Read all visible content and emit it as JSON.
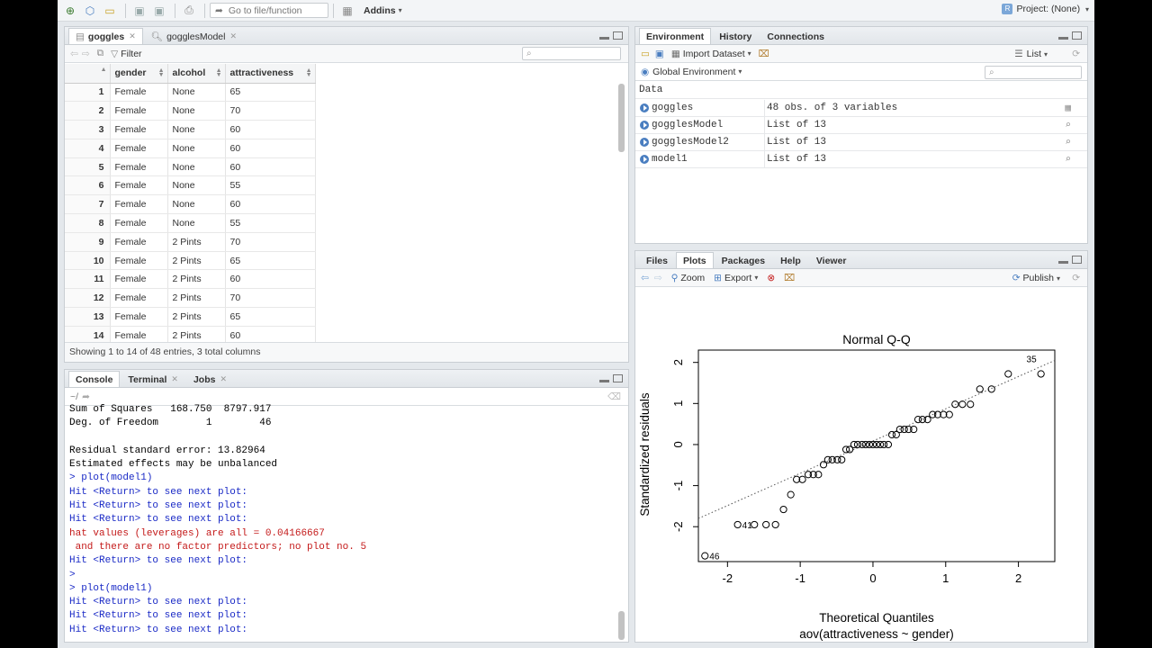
{
  "toolbar": {
    "goto_placeholder": "Go to file/function",
    "addins": "Addins",
    "project": "Project: (None)"
  },
  "source_pane": {
    "tabs": [
      {
        "label": "goggles",
        "active": true
      },
      {
        "label": "gogglesModel",
        "active": false
      }
    ],
    "filter_label": "Filter",
    "columns": [
      "gender",
      "alcohol",
      "attractiveness"
    ],
    "rows": [
      [
        "1",
        "Female",
        "None",
        "65"
      ],
      [
        "2",
        "Female",
        "None",
        "70"
      ],
      [
        "3",
        "Female",
        "None",
        "60"
      ],
      [
        "4",
        "Female",
        "None",
        "60"
      ],
      [
        "5",
        "Female",
        "None",
        "60"
      ],
      [
        "6",
        "Female",
        "None",
        "55"
      ],
      [
        "7",
        "Female",
        "None",
        "60"
      ],
      [
        "8",
        "Female",
        "None",
        "55"
      ],
      [
        "9",
        "Female",
        "2 Pints",
        "70"
      ],
      [
        "10",
        "Female",
        "2 Pints",
        "65"
      ],
      [
        "11",
        "Female",
        "2 Pints",
        "60"
      ],
      [
        "12",
        "Female",
        "2 Pints",
        "70"
      ],
      [
        "13",
        "Female",
        "2 Pints",
        "65"
      ],
      [
        "14",
        "Female",
        "2 Pints",
        "60"
      ]
    ],
    "footer": "Showing 1 to 14 of 48 entries, 3 total columns"
  },
  "console_pane": {
    "tabs": [
      "Console",
      "Terminal",
      "Jobs"
    ],
    "path": "~/",
    "lines": [
      {
        "t": "out",
        "text": "Sum of Squares   168.750  8797.917"
      },
      {
        "t": "out",
        "text": "Deg. of Freedom        1        46"
      },
      {
        "t": "out",
        "text": ""
      },
      {
        "t": "out",
        "text": "Residual standard error: 13.82964"
      },
      {
        "t": "out",
        "text": "Estimated effects may be unbalanced"
      },
      {
        "t": "cmd",
        "text": "> plot(model1)"
      },
      {
        "t": "info",
        "text": "Hit <Return> to see next plot:"
      },
      {
        "t": "info",
        "text": "Hit <Return> to see next plot:"
      },
      {
        "t": "info",
        "text": "Hit <Return> to see next plot:"
      },
      {
        "t": "err",
        "text": "hat values (leverages) are all = 0.04166667"
      },
      {
        "t": "err",
        "text": " and there are no factor predictors; no plot no. 5"
      },
      {
        "t": "info",
        "text": "Hit <Return> to see next plot:"
      },
      {
        "t": "cmd",
        "text": ">"
      },
      {
        "t": "cmd",
        "text": "> plot(model1)"
      },
      {
        "t": "info",
        "text": "Hit <Return> to see next plot:"
      },
      {
        "t": "info",
        "text": "Hit <Return> to see next plot:"
      },
      {
        "t": "info",
        "text": "Hit <Return> to see next plot:"
      }
    ]
  },
  "env_pane": {
    "tabs": [
      {
        "label": "Environment",
        "active": true
      },
      {
        "label": "History",
        "active": false
      },
      {
        "label": "Connections",
        "active": false
      }
    ],
    "import_label": "Import Dataset",
    "view_mode": "List",
    "scope": "Global Environment",
    "section": "Data",
    "items": [
      {
        "name": "goggles",
        "value": "48 obs. of 3 variables",
        "icon": "table-icon"
      },
      {
        "name": "gogglesModel",
        "value": "List of 13",
        "icon": "magnifier-icon"
      },
      {
        "name": "gogglesModel2",
        "value": "List of 13",
        "icon": "magnifier-icon"
      },
      {
        "name": "model1",
        "value": "List of 13",
        "icon": "magnifier-icon"
      }
    ]
  },
  "files_pane": {
    "tabs": [
      {
        "label": "Files",
        "active": false
      },
      {
        "label": "Plots",
        "active": true
      },
      {
        "label": "Packages",
        "active": false
      },
      {
        "label": "Help",
        "active": false
      },
      {
        "label": "Viewer",
        "active": false
      }
    ],
    "zoom_label": "Zoom",
    "export_label": "Export",
    "publish_label": "Publish"
  },
  "chart_data": {
    "type": "scatter",
    "title": "Normal Q-Q",
    "xlabel": "Theoretical Quantiles",
    "subtitle": "aov(attractiveness ~ gender)",
    "ylabel": "Standardized residuals",
    "xlim": [
      -2.4,
      2.5
    ],
    "ylim": [
      -2.85,
      2.3
    ],
    "xticks": [
      -2,
      -1,
      0,
      1,
      2
    ],
    "yticks": [
      -2,
      -1,
      0,
      1,
      2
    ],
    "reference_line": {
      "x": [
        -2.4,
        2.5
      ],
      "y": [
        -1.8,
        2.05
      ]
    },
    "x": [
      -2.31,
      -1.86,
      -1.63,
      -1.47,
      -1.34,
      -1.23,
      -1.13,
      -1.05,
      -0.97,
      -0.89,
      -0.82,
      -0.75,
      -0.68,
      -0.62,
      -0.56,
      -0.49,
      -0.43,
      -0.37,
      -0.32,
      -0.26,
      -0.21,
      -0.15,
      -0.1,
      -0.05,
      0.0,
      0.05,
      0.1,
      0.15,
      0.21,
      0.26,
      0.32,
      0.37,
      0.43,
      0.49,
      0.56,
      0.62,
      0.68,
      0.75,
      0.82,
      0.89,
      0.97,
      1.05,
      1.13,
      1.23,
      1.34,
      1.47,
      1.63,
      1.86,
      2.31
    ],
    "y": [
      -2.71,
      -1.95,
      -1.95,
      -1.95,
      -1.95,
      -1.58,
      -1.22,
      -0.85,
      -0.85,
      -0.73,
      -0.73,
      -0.73,
      -0.49,
      -0.37,
      -0.37,
      -0.37,
      -0.37,
      -0.12,
      -0.12,
      0.0,
      0.0,
      0.0,
      0.0,
      0.0,
      0.0,
      0.0,
      0.0,
      0.0,
      0.0,
      0.24,
      0.24,
      0.37,
      0.37,
      0.37,
      0.37,
      0.61,
      0.61,
      0.61,
      0.73,
      0.73,
      0.73,
      0.73,
      0.98,
      0.98,
      0.98,
      1.35,
      1.35,
      1.72,
      1.72,
      2.09
    ],
    "labels": [
      {
        "x": -2.31,
        "y": -2.71,
        "text": "46",
        "side": "right"
      },
      {
        "x": -1.86,
        "y": -1.95,
        "text": "41",
        "side": "right"
      },
      {
        "x": 2.31,
        "y": 2.09,
        "text": "35",
        "side": "left"
      }
    ]
  }
}
